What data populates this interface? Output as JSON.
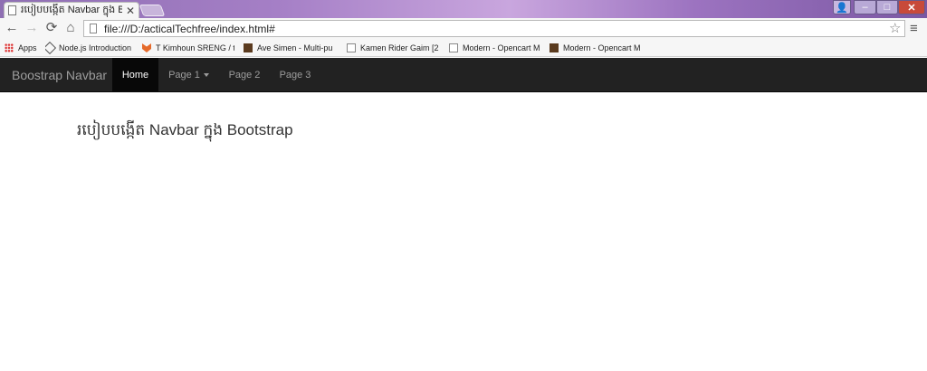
{
  "browser": {
    "tab": {
      "title": "របៀបបង្កើត Navbar ក្នុង Bootstrap",
      "close": "✕"
    },
    "window_controls": {
      "user": "👤",
      "minimize": "–",
      "maximize": "□",
      "close": "✕"
    },
    "nav": {
      "back": "←",
      "forward": "→",
      "reload": "⟳",
      "home": "⌂"
    },
    "url": "file:///D:/acticalTechfree/index.html#",
    "star": "☆",
    "menu": "≡",
    "bookmarks": [
      {
        "label": "Apps",
        "icon": "apps-icon"
      },
      {
        "label": "Node.js Introduction",
        "icon": "nodejs-icon"
      },
      {
        "label": "T Kimhoun SRENG / t",
        "icon": "gitlab-icon"
      },
      {
        "label": "Ave Simen - Multi-pu",
        "icon": "thumbnail-icon"
      },
      {
        "label": "Kamen Rider Gaim [2",
        "icon": "page-icon"
      },
      {
        "label": "Modern - Opencart M",
        "icon": "page-icon"
      },
      {
        "label": "Modern - Opencart M",
        "icon": "thumbnail-icon"
      }
    ]
  },
  "navbar": {
    "brand": "Boostrap Navbar",
    "items": [
      {
        "label": "Home",
        "active": true
      },
      {
        "label": "Page 1",
        "dropdown": true
      },
      {
        "label": "Page 2"
      },
      {
        "label": "Page 3"
      }
    ]
  },
  "content": {
    "heading": "របៀបបង្កើត Navbar ក្នុង Bootstrap"
  },
  "colors": {
    "navbar_bg": "#222222",
    "navbar_active_bg": "#080808",
    "nav_text": "#9d9d9d",
    "active_text": "#ffffff"
  }
}
